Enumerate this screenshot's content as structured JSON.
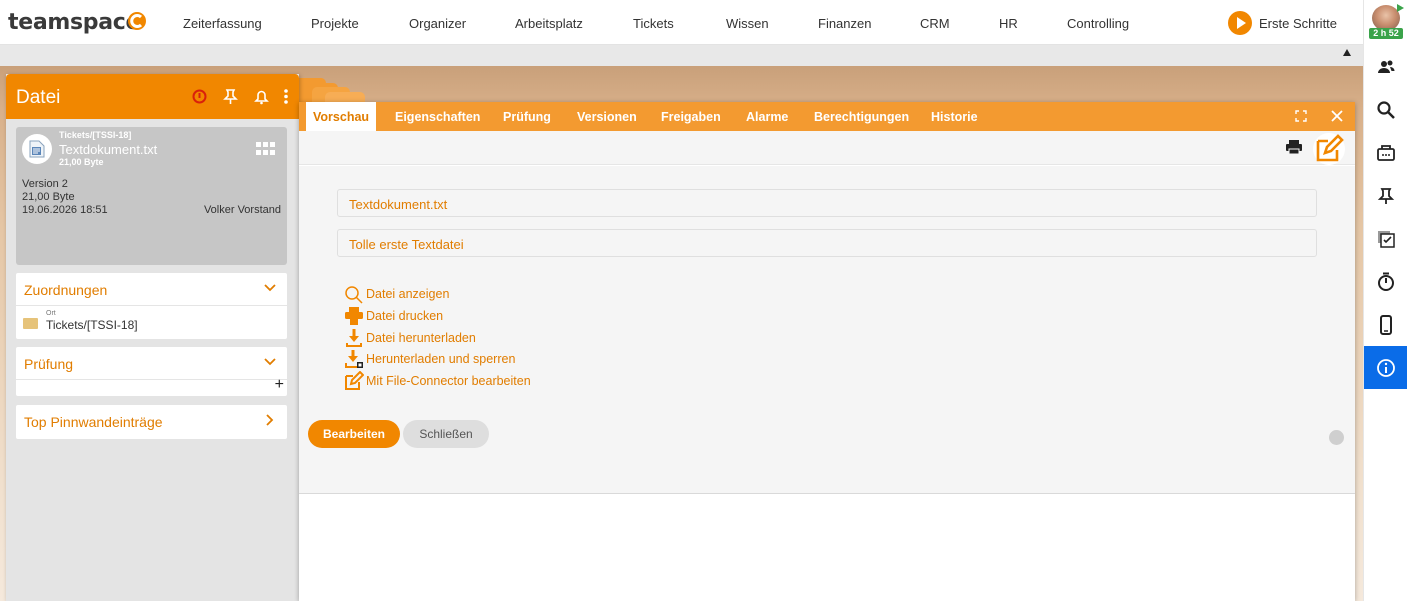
{
  "app": {
    "logo": "teamspace",
    "nav": [
      "Zeiterfassung",
      "Projekte",
      "Organizer",
      "Arbeitsplatz",
      "Tickets",
      "Wissen",
      "Finanzen",
      "CRM",
      "HR",
      "Controlling"
    ],
    "getting_started": "Erste Schritte",
    "timer": "2 h 52"
  },
  "right_sidebar": {
    "icons": [
      "contacts-icon",
      "search-icon",
      "inbox-icon",
      "pin-icon",
      "tasks-icon",
      "stopwatch-icon",
      "mobile-icon",
      "info-icon"
    ],
    "active": "info-icon",
    "active_color": "#0a6ce8"
  },
  "left_panel": {
    "title": "Datei",
    "header_icons": [
      "alarm-icon",
      "pin-icon",
      "bell-icon",
      "more-icon"
    ],
    "card": {
      "breadcrumb": "Tickets/[TSSI-18]",
      "file_name": "Textdokument.txt",
      "file_size": "21,00 Byte",
      "version": "Version 2",
      "size": "21,00 Byte",
      "date": "19.06.2026 18:51",
      "author": "Volker Vorstand"
    },
    "sections": {
      "zuordnungen": {
        "title": "Zuordnungen",
        "location_label": "Ort",
        "location_value": "Tickets/[TSSI-18]"
      },
      "pruefung": {
        "title": "Prüfung",
        "add": "+"
      },
      "pinnwand": {
        "title": "Top Pinnwandeinträge"
      }
    }
  },
  "dialog": {
    "tabs": [
      "Vorschau",
      "Eigenschaften",
      "Prüfung",
      "Versionen",
      "Freigaben",
      "Alarme",
      "Berechtigungen",
      "Historie"
    ],
    "active_tab": "Vorschau",
    "fields": {
      "name": "Textdokument.txt",
      "description": "Tolle erste Textdatei"
    },
    "actions": [
      {
        "label": "Datei anzeigen",
        "icon": "magnifier-icon"
      },
      {
        "label": "Datei drucken",
        "icon": "printer-icon"
      },
      {
        "label": "Datei herunterladen",
        "icon": "download-icon"
      },
      {
        "label": "Herunterladen und sperren",
        "icon": "download-lock-icon"
      },
      {
        "label": "Mit File-Connector bearbeiten",
        "icon": "edit-icon"
      }
    ],
    "buttons": {
      "edit": "Bearbeiten",
      "close": "Schließen"
    }
  },
  "colors": {
    "accent": "#f18700",
    "tab_bar": "#f39a30",
    "link": "#e17d00"
  }
}
